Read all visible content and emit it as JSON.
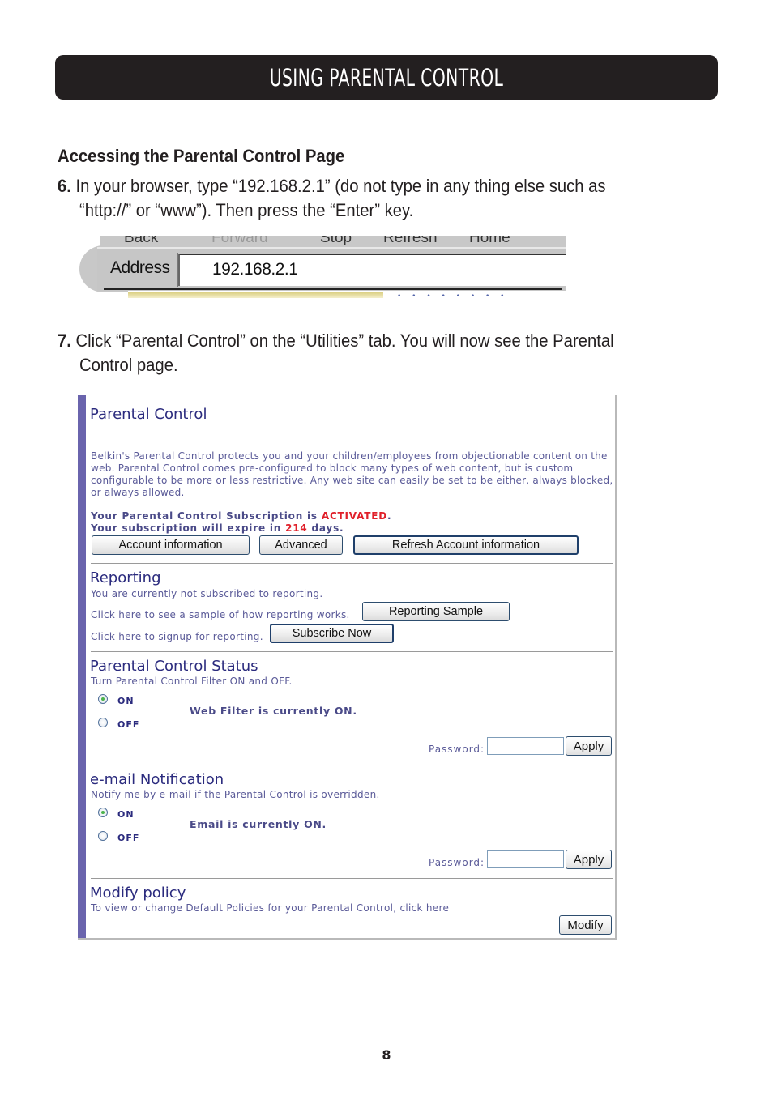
{
  "banner": {
    "title": "USING PARENTAL CONTROL"
  },
  "section": {
    "heading": "Accessing the Parental Control Page"
  },
  "steps": [
    {
      "number": "6.",
      "line1": "In your browser, type “192.168.2.1” (do not type in any thing else such as",
      "line2": "“http://” or “www”). Then press the “Enter” key."
    },
    {
      "number": "7.",
      "line1": "Click “Parental Control” on the “Utilities” tab. You will now see the Parental",
      "line2": "Control page."
    }
  ],
  "browser": {
    "toolbar": [
      "Back",
      "Forward",
      "Stop",
      "Refresh",
      "Home"
    ],
    "address_label": "Address",
    "address_value": "192.168.2.1"
  },
  "panel": {
    "parental_control": {
      "title": "Parental Control",
      "description": "Belkin's Parental Control protects you and your children/employees from objectionable content on the web. Parental Control comes pre-configured to block many types of web content, but is custom configurable to be more or less restrictive. Any web site can easily be set to be either, always blocked, or always allowed.",
      "subscription_prefix": "Your Parental Control Subscription is ",
      "subscription_status": "ACTIVATED",
      "subscription_suffix": ".",
      "expire_prefix": "Your subscription will expire in ",
      "expire_days": "214",
      "expire_suffix": " days.",
      "buttons": {
        "account_info": "Account information",
        "advanced": "Advanced",
        "refresh": "Refresh Account information"
      }
    },
    "reporting": {
      "title": "Reporting",
      "status": "You are currently not subscribed to reporting.",
      "sample_prompt": "Click here to see a sample of how reporting works.",
      "sample_button": "Reporting Sample",
      "signup_prompt": "Click here to signup for reporting.",
      "signup_button": "Subscribe Now"
    },
    "status": {
      "title": "Parental Control Status",
      "subtitle": "Turn Parental Control Filter ON and OFF.",
      "on_label": "ON",
      "off_label": "OFF",
      "selected": "ON",
      "message": "Web Filter is currently ON.",
      "password_label": "Password:",
      "password_value": "",
      "apply_button": "Apply"
    },
    "email": {
      "title": "e-mail Notification",
      "subtitle": "Notify me by e-mail if the Parental Control is overridden.",
      "on_label": "ON",
      "off_label": "OFF",
      "selected": "ON",
      "message": "Email is currently ON.",
      "password_label": "Password:",
      "password_value": "",
      "apply_button": "Apply"
    },
    "modify": {
      "title": "Modify policy",
      "subtitle": "To view or change Default Policies for your Parental Control, click here",
      "button": "Modify"
    }
  },
  "page_number": "8"
}
